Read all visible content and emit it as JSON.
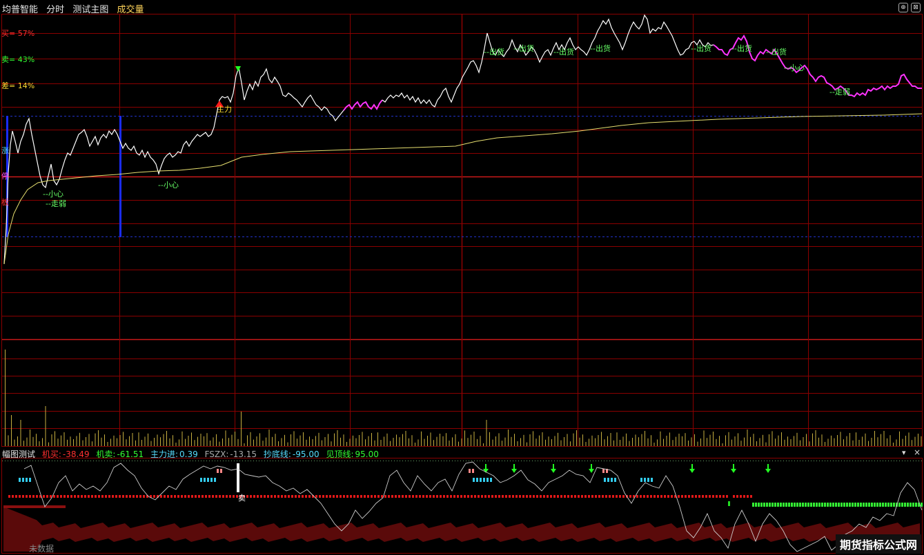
{
  "header": {
    "stock_name": "均普智能",
    "view_mode": "分时",
    "template": "测试主图",
    "volume_label": "成交量",
    "btn_add": "⊕",
    "btn_close": "⊠"
  },
  "stats": {
    "buy": "买= 57%",
    "sell": "卖= 43%",
    "diff": "差= 14%"
  },
  "limit_chars": [
    "涨",
    "停",
    "板"
  ],
  "annotations": {
    "careful_1": "--小心",
    "weak_1": "--走弱",
    "careful_2": "--小心",
    "main_force": "主力",
    "sell_out": "--出货",
    "careful_3": "--小心",
    "weak_2": "--走弱"
  },
  "indicator_header": {
    "name": "幅图测试",
    "jimai_label": "机买:",
    "jimai_value": "-38.49",
    "jimai2_label": "机卖:",
    "jimai2_value": "-61.51",
    "zhulijin_label": "主力进:",
    "zhulijin_value": "0.39",
    "fszx_label": "FSZX:",
    "fszx_value": "-13.15",
    "chaodi_label": "抄底线:",
    "chaodi_value": "-95.00",
    "jianding_label": "见顶线:",
    "jianding_value": "95.00",
    "dropdown_icon": "▾",
    "close_icon": "×"
  },
  "sell_marker": "卖",
  "no_data": "未数据",
  "watermark": "期货指标公式网",
  "colors": {
    "grid": "#8b0000",
    "price": "#ffffff",
    "price_magenta": "#ff33ff",
    "avg": "#e8e070",
    "limit_bar": "#1a2cff",
    "dashed": "#2233cc",
    "volume": "#c8b040",
    "buy_text": "#ff3030",
    "sell_text": "#33ff33",
    "diff_text": "#ffdd33",
    "signal_text": "#66ff66"
  }
}
